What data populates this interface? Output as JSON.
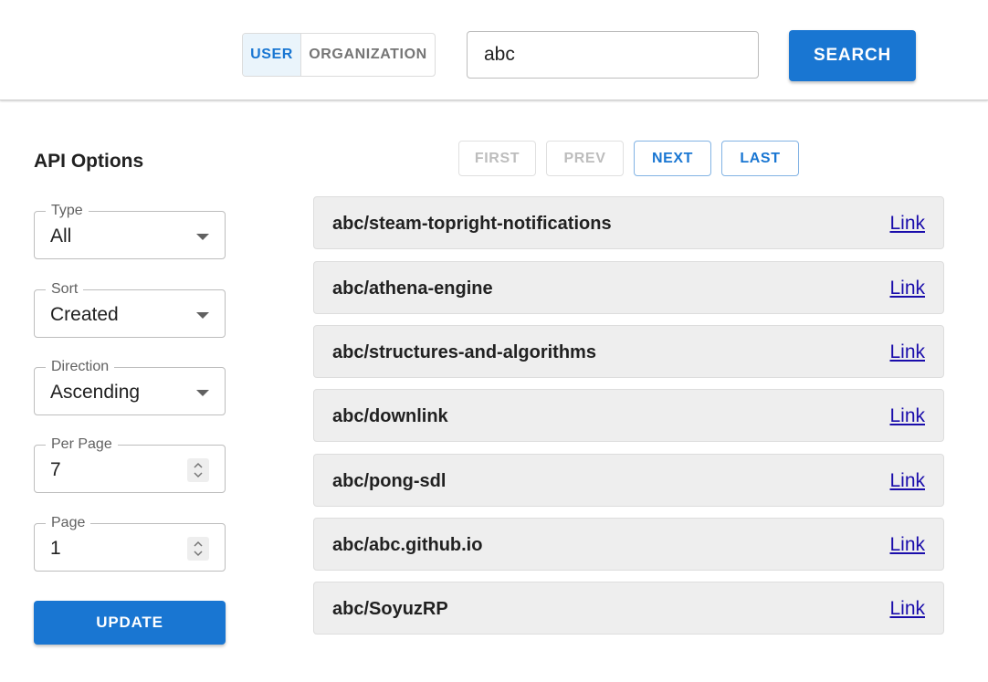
{
  "header": {
    "toggle": {
      "options": [
        "USER",
        "ORGANIZATION"
      ],
      "selected": "USER"
    },
    "search": {
      "value": "abc"
    },
    "search_button_label": "SEARCH"
  },
  "sidebar": {
    "title": "API Options",
    "fields": [
      {
        "label": "Type",
        "value": "All",
        "control": "select"
      },
      {
        "label": "Sort",
        "value": "Created",
        "control": "select"
      },
      {
        "label": "Direction",
        "value": "Ascending",
        "control": "select"
      },
      {
        "label": "Per Page",
        "value": "7",
        "control": "number"
      },
      {
        "label": "Page",
        "value": "1",
        "control": "number"
      }
    ],
    "update_button_label": "UPDATE"
  },
  "pagination": {
    "first": {
      "label": "FIRST",
      "enabled": false
    },
    "prev": {
      "label": "PREV",
      "enabled": false
    },
    "next": {
      "label": "NEXT",
      "enabled": true
    },
    "last": {
      "label": "LAST",
      "enabled": true
    }
  },
  "results": [
    {
      "name": "abc/steam-topright-notifications",
      "link_label": "Link"
    },
    {
      "name": "abc/athena-engine",
      "link_label": "Link"
    },
    {
      "name": "abc/structures-and-algorithms",
      "link_label": "Link"
    },
    {
      "name": "abc/downlink",
      "link_label": "Link"
    },
    {
      "name": "abc/pong-sdl",
      "link_label": "Link"
    },
    {
      "name": "abc/abc.github.io",
      "link_label": "Link"
    },
    {
      "name": "abc/SoyuzRP",
      "link_label": "Link"
    }
  ],
  "colors": {
    "primary": "#1976d2",
    "selected_toggle_bg": "#eaf4fb",
    "row_bg": "#eeeeee",
    "link": "#1a0dab"
  },
  "icons": {
    "select_caret": "caret-down-icon",
    "number_spinner": "spinner-up-down-icon"
  }
}
